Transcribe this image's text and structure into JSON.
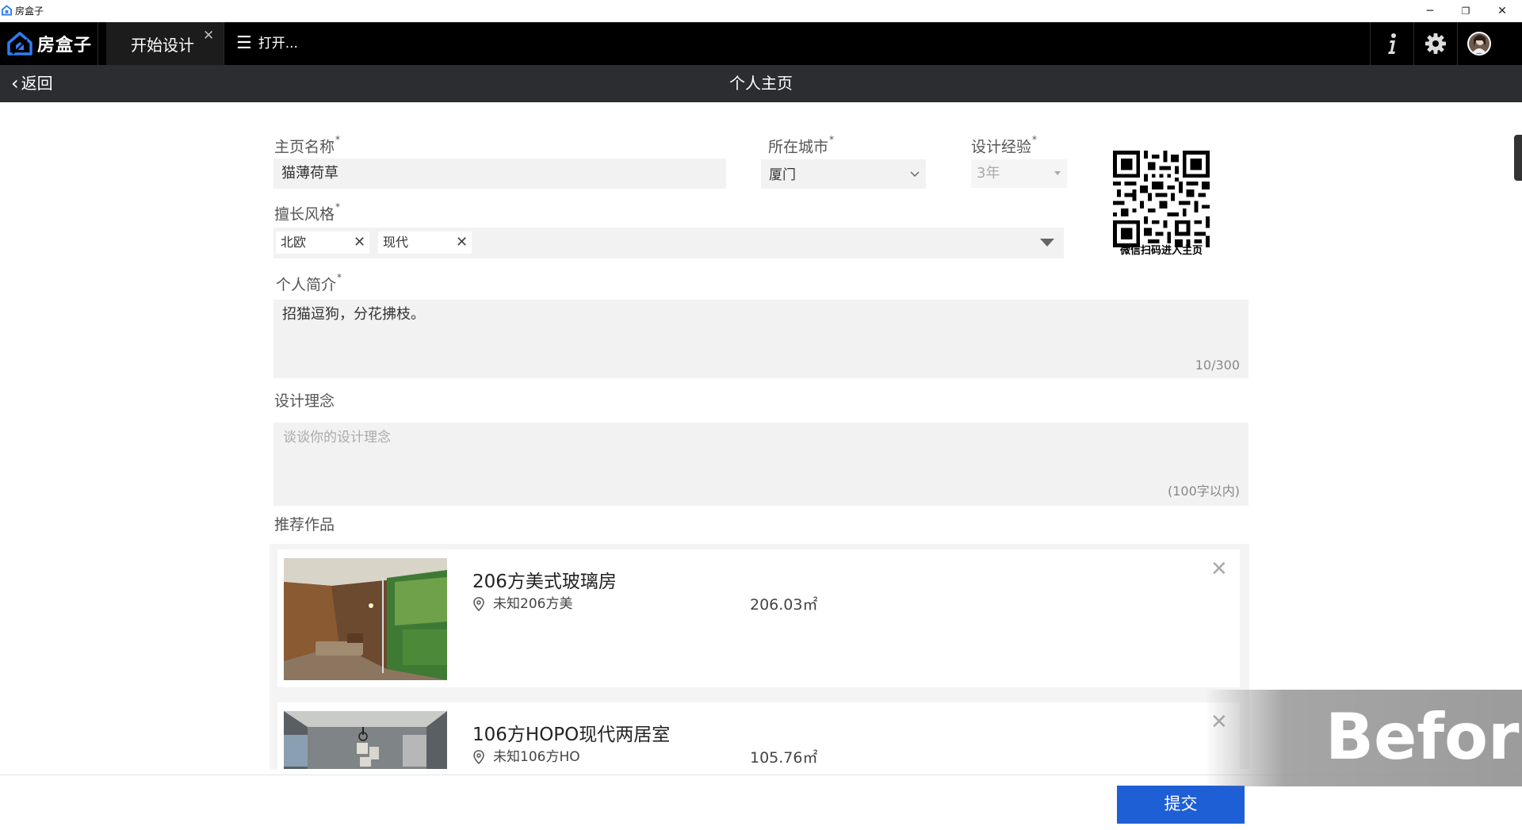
{
  "window": {
    "app_name": "房盒子",
    "minimize": "─",
    "restore": "❐",
    "close": "✕"
  },
  "toolbar": {
    "logo_text": "房盒子",
    "active_tab": "开始设计",
    "tab_close": "✕",
    "open_icon": "☰",
    "open_label": "打开...",
    "icons": [
      "info-icon",
      "gear-icon",
      "avatar"
    ]
  },
  "header": {
    "back_icon": "‹",
    "back_label": "返回",
    "title": "个人主页"
  },
  "form": {
    "homepage_name": {
      "label": "主页名称",
      "value": "猫薄荷草"
    },
    "city": {
      "label": "所在城市",
      "value": "厦门"
    },
    "experience": {
      "label": "设计经验",
      "value": "3年"
    },
    "styles": {
      "label": "擅长风格",
      "tags": [
        "北欧",
        "现代"
      ],
      "tag_remove": "✕"
    },
    "bio": {
      "label": "个人简介",
      "value": "招猫逗狗，分花拂枝。",
      "counter": "10/300"
    },
    "philosophy": {
      "label": "设计理念",
      "placeholder": "谈谈你的设计理念",
      "hint": "(100字以内)"
    },
    "required_mark": "*"
  },
  "qr": {
    "caption": "微信扫码进入主页"
  },
  "works": {
    "label": "推荐作品",
    "remove_icon": "✕",
    "items": [
      {
        "title": "206方美式玻璃房",
        "location": "未知206方美",
        "area": "206.03㎡"
      },
      {
        "title": "106方HOPO现代两居室",
        "location": "未知106方HO",
        "area": "105.76㎡"
      }
    ]
  },
  "footer": {
    "submit_label": "提交"
  },
  "overlay": {
    "text": "Befor"
  },
  "colors": {
    "topbar": "#000000",
    "subbar": "#2b2d30",
    "accent": "#1f5fd6",
    "field_bg": "#f2f2f2"
  }
}
